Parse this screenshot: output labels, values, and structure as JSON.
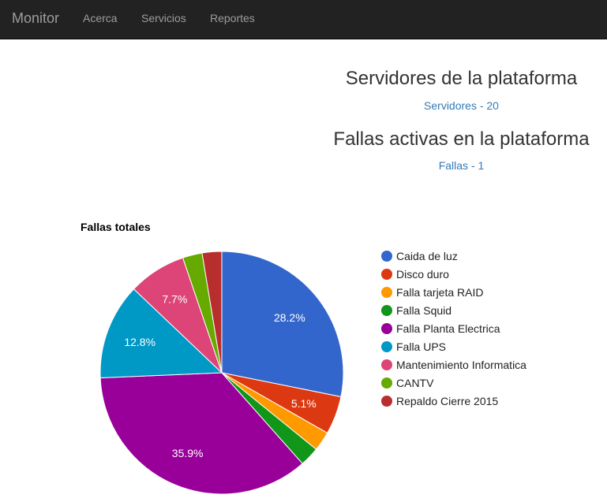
{
  "navbar": {
    "brand": "Monitor",
    "links": [
      "Acerca",
      "Servicios",
      "Reportes"
    ]
  },
  "servers": {
    "title": "Servidores de la plataforma",
    "link": "Servidores - 20"
  },
  "failures": {
    "title": "Fallas activas en la plataforma",
    "link": "Fallas - 1"
  },
  "chart_data": {
    "type": "pie",
    "title": "Fallas totales",
    "legend_position": "right",
    "slices": [
      {
        "name": "Caida de luz",
        "value": 28.2,
        "color": "#3366cc",
        "label": "28.2%"
      },
      {
        "name": "Disco duro",
        "value": 5.1,
        "color": "#dc3912",
        "label": "5.1%"
      },
      {
        "name": "Falla tarjeta RAID",
        "value": 2.6,
        "color": "#ff9900",
        "label": ""
      },
      {
        "name": "Falla Squid",
        "value": 2.6,
        "color": "#109618",
        "label": ""
      },
      {
        "name": "Falla Planta Electrica",
        "value": 35.9,
        "color": "#990099",
        "label": "35.9%"
      },
      {
        "name": "Falla UPS",
        "value": 12.8,
        "color": "#0099c6",
        "label": "12.8%"
      },
      {
        "name": "Mantenimiento Informatica",
        "value": 7.7,
        "color": "#dd4477",
        "label": "7.7%"
      },
      {
        "name": "CANTV",
        "value": 2.6,
        "color": "#66aa00",
        "label": ""
      },
      {
        "name": "Repaldo Cierre 2015",
        "value": 2.6,
        "color": "#b82e2e",
        "label": ""
      }
    ]
  }
}
